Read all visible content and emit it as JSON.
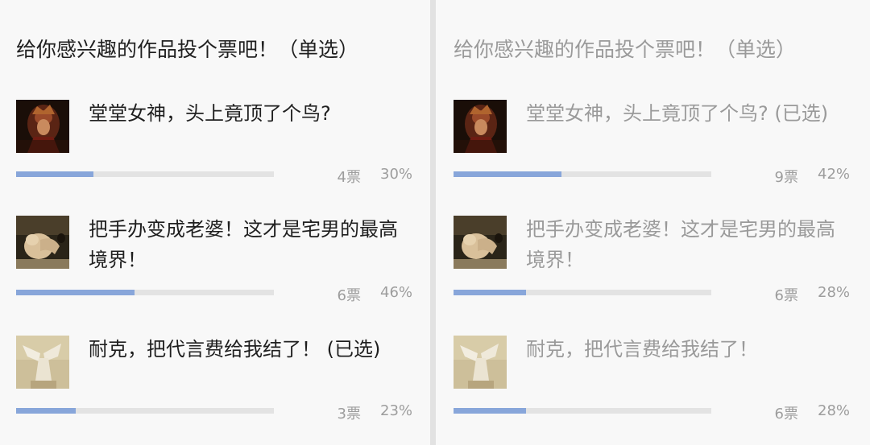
{
  "colors": {
    "bar_fill": "#88a6da",
    "bar_track": "#e3e3e3",
    "text_dark": "#1f1f1f",
    "text_gray": "#9a9a9a"
  },
  "left_poll": {
    "title": "给你感兴趣的作品投个票吧！（单选）",
    "options": [
      {
        "label": "堂堂女神，头上竟顶了个鸟?",
        "votes": "4票",
        "percent": "30%",
        "fill": 0.3,
        "thumb": "goddess-painting-thumbnail"
      },
      {
        "label": "把手办变成老婆！这才是宅男的最高境界！",
        "votes": "6票",
        "percent": "46%",
        "fill": 0.46,
        "thumb": "sculpture-thumbnail"
      },
      {
        "label": "耐克，把代言费给我结了！ (已选)",
        "votes": "3票",
        "percent": "23%",
        "fill": 0.23,
        "thumb": "winged-victory-thumbnail"
      }
    ]
  },
  "right_poll": {
    "title": "给你感兴趣的作品投个票吧！（单选）",
    "options": [
      {
        "label": "堂堂女神，头上竟顶了个鸟? (已选)",
        "votes": "9票",
        "percent": "42%",
        "fill": 0.42,
        "thumb": "goddess-painting-thumbnail"
      },
      {
        "label": "把手办变成老婆！这才是宅男的最高境界！",
        "votes": "6票",
        "percent": "28%",
        "fill": 0.28,
        "thumb": "sculpture-thumbnail"
      },
      {
        "label": "耐克，把代言费给我结了！",
        "votes": "6票",
        "percent": "28%",
        "fill": 0.28,
        "thumb": "winged-victory-thumbnail"
      }
    ]
  }
}
